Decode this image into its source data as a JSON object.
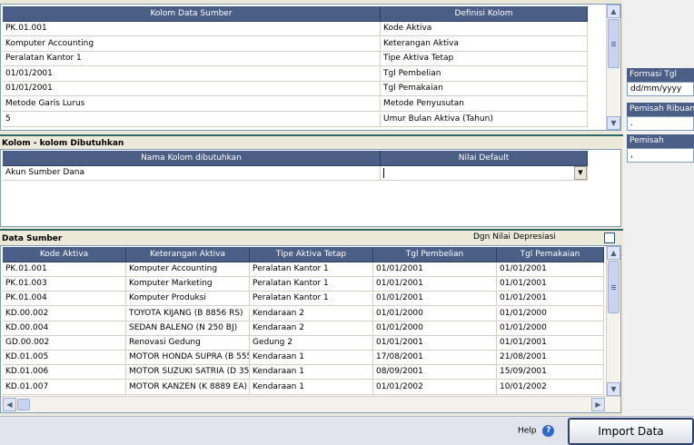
{
  "mapping": {
    "headers": [
      "Kolom Data Sumber",
      "Definisi Kolom"
    ],
    "rows": [
      [
        "PK.01.001",
        "Kode Aktiva"
      ],
      [
        "Komputer Accounting",
        "Keterangan Aktiva"
      ],
      [
        "Peralatan Kantor 1",
        "Tipe Aktiva Tetap"
      ],
      [
        "01/01/2001",
        "Tgl Pembelian"
      ],
      [
        "01/01/2001",
        "Tgl Pemakaian"
      ],
      [
        "Metode Garis Lurus",
        "Metode Penyusutan"
      ],
      [
        "5",
        "Umur Bulan Aktiva (Tahun)"
      ]
    ]
  },
  "required": {
    "title": "Kolom - kolom Dibutuhkan",
    "headers": [
      "Nama Kolom dibutuhkan",
      "Nilai Default"
    ],
    "rows": [
      [
        "Akun Sumber Dana",
        ""
      ]
    ]
  },
  "source": {
    "title": "Data Sumber",
    "checkbox_label": "Dgn Nilai Depresiasi",
    "checkbox_checked": false,
    "headers": [
      "Kode Aktiva",
      "Keterangan Aktiva",
      "Tipe Aktiva Tetap",
      "Tgl Pembelian",
      "Tgl Pemakaian"
    ],
    "rows": [
      [
        "PK.01.001",
        "Komputer Accounting",
        "Peralatan Kantor 1",
        "01/01/2001",
        "01/01/2001"
      ],
      [
        "PK.01.003",
        "Komputer Marketing",
        "Peralatan Kantor 1",
        "01/01/2001",
        "01/01/2001"
      ],
      [
        "PK.01.004",
        "Komputer Produksi",
        "Peralatan Kantor 1",
        "01/01/2001",
        "01/01/2001"
      ],
      [
        "KD.00.002",
        "TOYOTA KIJANG (B 8856 RS)",
        "Kendaraan 2",
        "01/01/2000",
        "01/01/2000"
      ],
      [
        "KD.00.004",
        "SEDAN BALENO (N 250 BJ)",
        "Kendaraan 2",
        "01/01/2000",
        "01/01/2000"
      ],
      [
        "GD.00.002",
        "Renovasi Gedung",
        "Gedung 2",
        "01/01/2001",
        "01/01/2001"
      ],
      [
        "KD.01.005",
        "MOTOR HONDA SUPRA (B 5555",
        "Kendaraan 1",
        "17/08/2001",
        "21/08/2001"
      ],
      [
        "KD.01.006",
        "MOTOR SUZUKI SATRIA (D 35",
        "Kendaraan 1",
        "08/09/2001",
        "15/09/2001"
      ],
      [
        "KD.01.007",
        "MOTOR KANZEN (K 8889 EA)",
        "Kendaraan 1",
        "01/01/2002",
        "10/01/2002"
      ]
    ]
  },
  "settings": {
    "date_format_label": "Formasi Tgl",
    "date_format_value": "dd/mm/yyyy",
    "thousand_sep_label": "Pemisah Ribuan",
    "thousand_sep_value": ".",
    "separator_label": "Pemisah",
    "separator_value": ","
  },
  "footer": {
    "help_label": "Help",
    "import_label": "Import Data"
  },
  "colors": {
    "header_bg": "#4b5e86",
    "divider": "#2d6b6b",
    "help_icon": "#2f6ac9"
  }
}
